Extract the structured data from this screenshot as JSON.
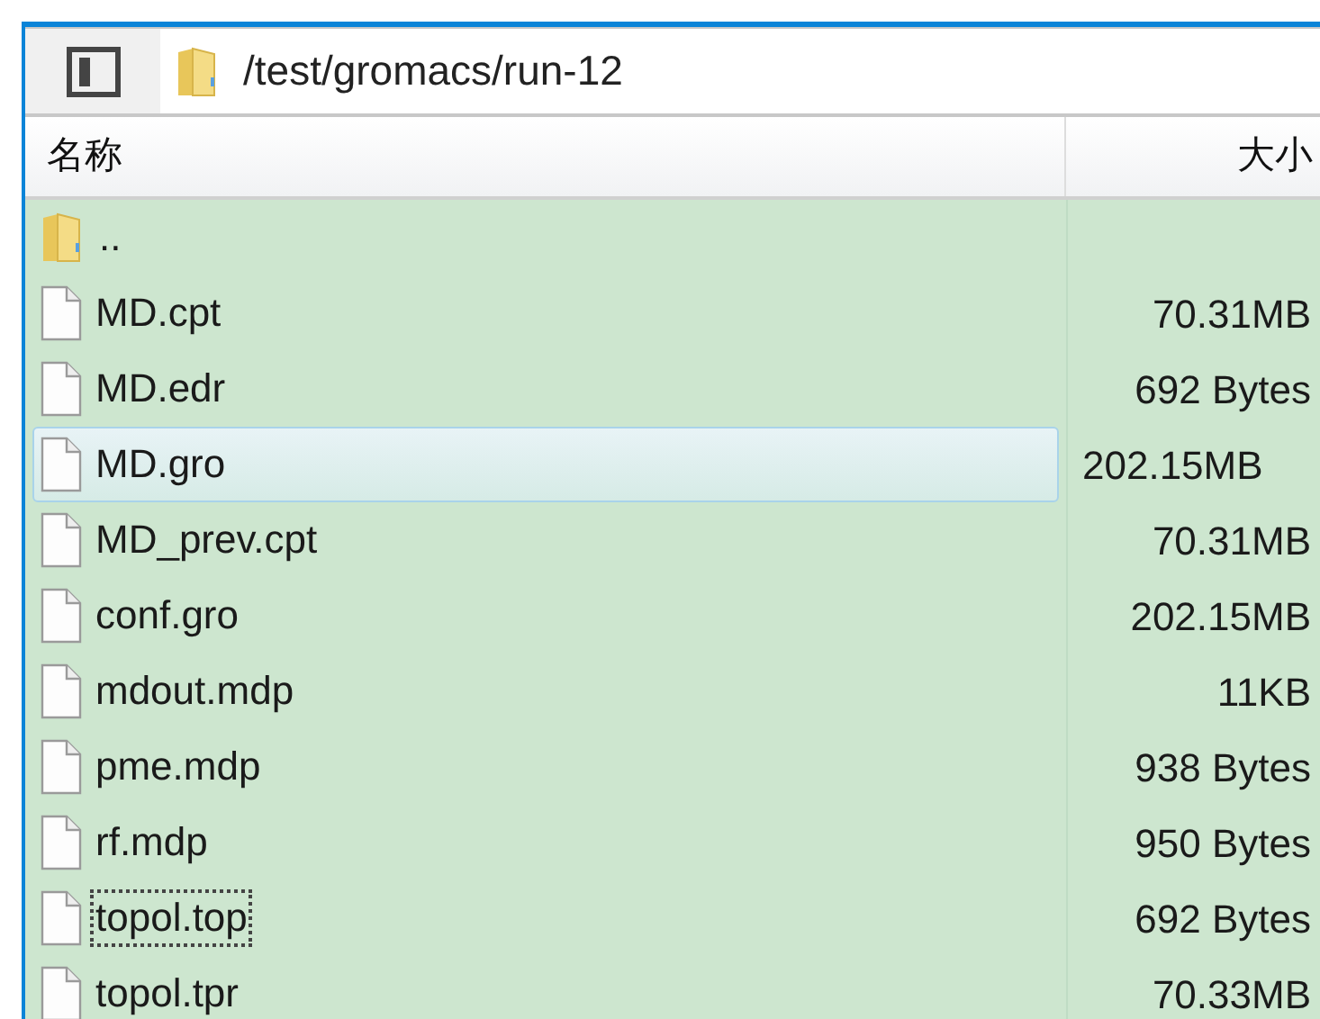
{
  "path": "/test/gromacs/run-12",
  "columns": [
    "名称",
    "大小"
  ],
  "rows": [
    {
      "kind": "folder",
      "name": "..",
      "size": "",
      "selected": false,
      "focused": false
    },
    {
      "kind": "file",
      "name": "MD.cpt",
      "size": "70.31MB",
      "selected": false,
      "focused": false
    },
    {
      "kind": "file",
      "name": "MD.edr",
      "size": "692 Bytes",
      "selected": false,
      "focused": false
    },
    {
      "kind": "file",
      "name": "MD.gro",
      "size": "202.15MB",
      "selected": true,
      "focused": false
    },
    {
      "kind": "file",
      "name": "MD_prev.cpt",
      "size": "70.31MB",
      "selected": false,
      "focused": false
    },
    {
      "kind": "file",
      "name": "conf.gro",
      "size": "202.15MB",
      "selected": false,
      "focused": false
    },
    {
      "kind": "file",
      "name": "mdout.mdp",
      "size": "11KB",
      "selected": false,
      "focused": false
    },
    {
      "kind": "file",
      "name": "pme.mdp",
      "size": "938 Bytes",
      "selected": false,
      "focused": false
    },
    {
      "kind": "file",
      "name": "rf.mdp",
      "size": "950 Bytes",
      "selected": false,
      "focused": false
    },
    {
      "kind": "file",
      "name": "topol.top",
      "size": "692 Bytes",
      "selected": false,
      "focused": true
    },
    {
      "kind": "file",
      "name": "topol.tpr",
      "size": "70.33MB",
      "selected": false,
      "focused": false
    }
  ]
}
